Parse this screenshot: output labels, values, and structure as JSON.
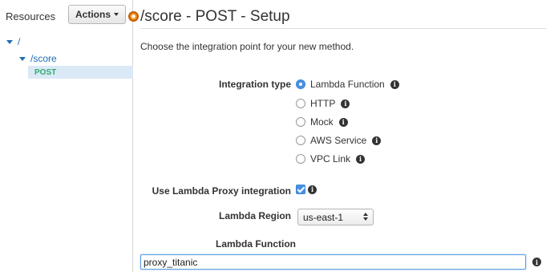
{
  "sidebar": {
    "title": "Resources",
    "actions_label": "Actions",
    "tree": {
      "root": "/",
      "score": "/score",
      "post": "POST"
    }
  },
  "header": {
    "title": "/score - POST - Setup"
  },
  "intro": "Choose the integration point for your new method.",
  "form": {
    "integration_type_label": "Integration type",
    "integration_options": [
      {
        "label": "Lambda Function",
        "selected": true
      },
      {
        "label": "HTTP",
        "selected": false
      },
      {
        "label": "Mock",
        "selected": false
      },
      {
        "label": "AWS Service",
        "selected": false
      },
      {
        "label": "VPC Link",
        "selected": false
      }
    ],
    "proxy_label": "Use Lambda Proxy integration",
    "proxy_checked": true,
    "region_label": "Lambda Region",
    "region_value": "us-east-1",
    "function_label": "Lambda Function",
    "function_value": "proxy_titanic"
  },
  "colors": {
    "link": "#1f6fb2",
    "method_post": "#2eab6f",
    "selected_row": "#dbe9f6",
    "accent": "#4a90e2",
    "indicator": "#f08c1f"
  },
  "icons": {
    "info": "info-circle-icon",
    "expand": "triangle-down-icon",
    "status": "orange-status-dot-icon"
  }
}
